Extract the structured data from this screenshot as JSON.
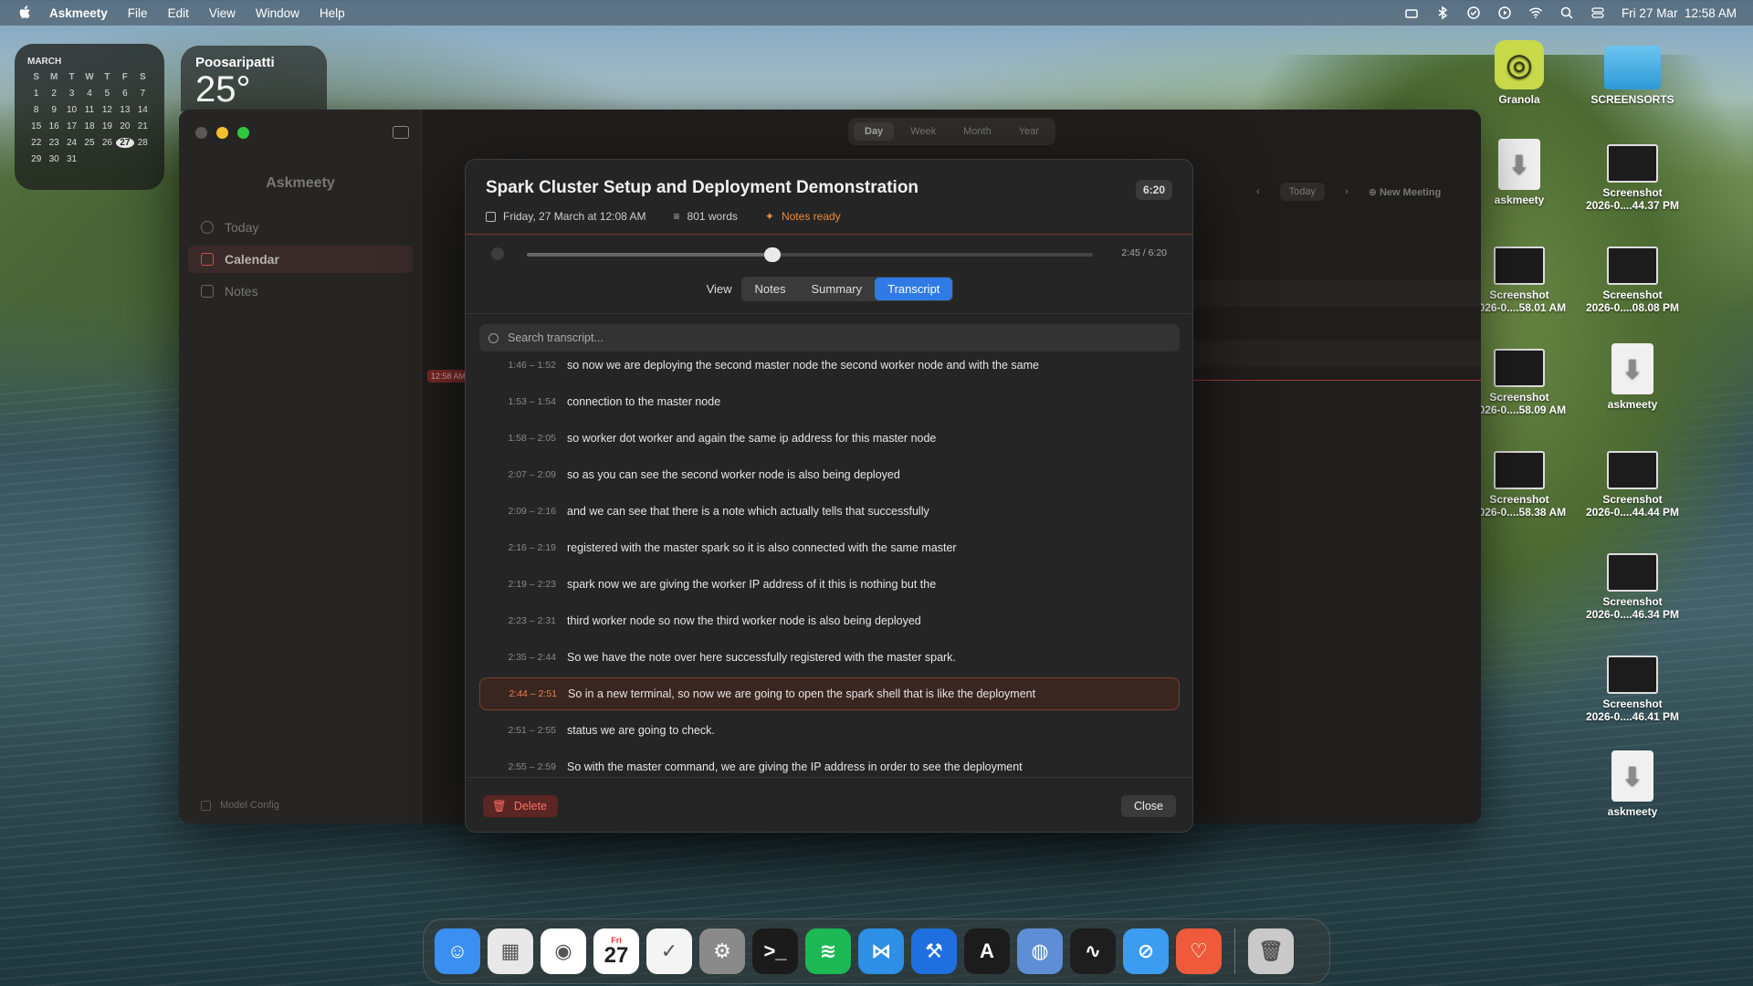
{
  "menubar": {
    "app_name": "Askmeety",
    "items": [
      "File",
      "Edit",
      "View",
      "Window",
      "Help"
    ],
    "clock": "Fri 27 Mar  12:58 AM"
  },
  "calendar_widget": {
    "month": "MARCH",
    "weekdays": [
      "S",
      "M",
      "T",
      "W",
      "T",
      "F",
      "S"
    ],
    "days": [
      "1",
      "2",
      "3",
      "4",
      "5",
      "6",
      "7",
      "8",
      "9",
      "10",
      "11",
      "12",
      "13",
      "14",
      "15",
      "16",
      "17",
      "18",
      "19",
      "20",
      "21",
      "22",
      "23",
      "24",
      "25",
      "26",
      "27",
      "28",
      "29",
      "30",
      "31"
    ],
    "today": "27"
  },
  "weather_widget": {
    "city": "Poosaripatti",
    "temp": "25°"
  },
  "desktop_icons": [
    {
      "label": "Granola",
      "kind": "app"
    },
    {
      "label": "SCREENSORTS",
      "kind": "folder"
    },
    {
      "label": "askmeety",
      "kind": "download"
    },
    {
      "label": "Screenshot\n2026-0....44.37 PM",
      "kind": "shot"
    },
    {
      "label": "Screenshot\n2026-0....58.01 AM",
      "kind": "shot"
    },
    {
      "label": "Screenshot\n2026-0....08.08 PM",
      "kind": "shot"
    },
    {
      "label": "Screenshot\n2026-0....58.09 AM",
      "kind": "shot"
    },
    {
      "label": "askmeety",
      "kind": "download"
    },
    {
      "label": "Screenshot\n2026-0....58.38 AM",
      "kind": "shot"
    },
    {
      "label": "Screenshot\n2026-0....44.44 PM",
      "kind": "shot"
    },
    {
      "label": "Screenshot\n2026-0....46.34 PM",
      "kind": "shot"
    },
    {
      "label": "Screenshot\n2026-0....46.41 PM",
      "kind": "shot"
    },
    {
      "label": "askmeety",
      "kind": "download"
    }
  ],
  "sidebar": {
    "title": "Askmeety",
    "items": [
      {
        "label": "Today"
      },
      {
        "label": "Calendar"
      },
      {
        "label": "Notes"
      }
    ],
    "footer": "Model Config"
  },
  "calendar_view": {
    "modes": [
      "Day",
      "Week",
      "Month",
      "Year"
    ],
    "selected_mode": "Day",
    "today_button": "Today",
    "new_meeting": "New Meeting",
    "now_badge": "12:58 AM"
  },
  "meeting_modal": {
    "title": "Spark Cluster Setup and Deployment Demonstration",
    "duration": "6:20",
    "date": "Friday, 27 March at 12:08 AM",
    "words": "801 words",
    "status": "Notes ready",
    "playback": {
      "position_label": "2:45 / 6:20",
      "progress": 0.434
    },
    "view_label": "View",
    "tabs": [
      "Notes",
      "Summary",
      "Transcript"
    ],
    "selected_tab": "Transcript",
    "search_placeholder": "Search transcript...",
    "transcript": [
      {
        "time": "1:46 – 1:52",
        "text": "so now we are deploying the second master node the second worker node and with the same"
      },
      {
        "time": "1:53 – 1:54",
        "text": "connection to the master node"
      },
      {
        "time": "1:58 – 2:05",
        "text": "so worker dot worker and again the same ip address for this master node"
      },
      {
        "time": "2:07 – 2:09",
        "text": "so as you can see the second worker node is also being deployed"
      },
      {
        "time": "2:09 – 2:16",
        "text": "and we can see that there is a note which actually tells that successfully"
      },
      {
        "time": "2:16 – 2:19",
        "text": "registered with the master spark so it is also connected with the same master"
      },
      {
        "time": "2:19 – 2:23",
        "text": "spark now we are giving the worker IP address of it this is nothing but the"
      },
      {
        "time": "2:23 – 2:31",
        "text": "third worker node so now the third worker node is also being deployed"
      },
      {
        "time": "2:35 – 2:44",
        "text": "So we have the note over here successfully registered with the master spark."
      },
      {
        "time": "2:44 – 2:51",
        "text": "So in a new terminal, so now we are going to open the spark shell that is like the deployment",
        "active": true
      },
      {
        "time": "2:51 – 2:55",
        "text": "status we are going to check."
      },
      {
        "time": "2:55 – 2:59",
        "text": "So with the master command, we are giving the IP address in order to see the deployment"
      }
    ],
    "delete_label": "Delete",
    "close_label": "Close"
  },
  "dock": {
    "apps": [
      "Finder",
      "Launchpad",
      "Chrome",
      "Calendar",
      "Reminders",
      "System Settings",
      "Terminal",
      "Spotify",
      "VS Code",
      "Xcode",
      "Instruments",
      "Disk Utility",
      "Activity Monitor",
      "Safari",
      "Askmeety",
      "Trash"
    ],
    "calendar_day": "27",
    "calendar_weekday": "Fri"
  },
  "colors": {
    "accent": "#2f7ae5",
    "danger": "#ff6f62",
    "highlight": "#ee7d50"
  }
}
